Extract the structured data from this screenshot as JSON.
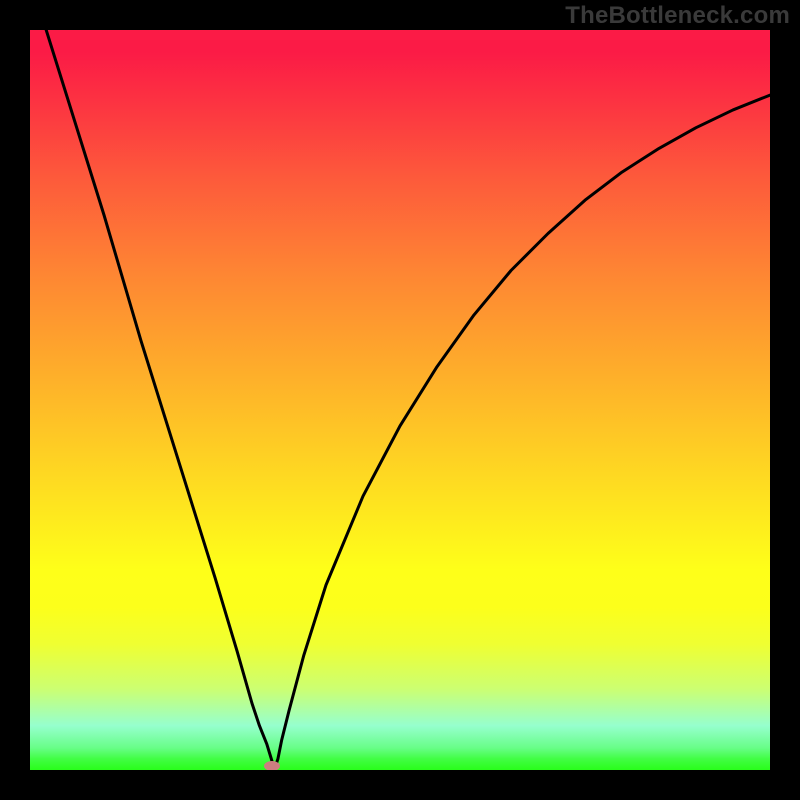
{
  "watermark": "TheBottleneck.com",
  "colors": {
    "frame": "#000000",
    "watermark": "#3a3a3a",
    "curve": "#000000",
    "marker": "#cd7e80",
    "gradient_top": "#fb1b46",
    "gradient_bottom": "#29fe1a"
  },
  "chart_data": {
    "type": "line",
    "title": "",
    "xlabel": "",
    "ylabel": "",
    "xlim": [
      0,
      1
    ],
    "ylim": [
      0,
      1
    ],
    "axes_visible": false,
    "background": "vertical red→yellow→green gradient",
    "annotations": [
      "bottleneck minimum marker near x≈0.33"
    ],
    "series": [
      {
        "name": "bottleneck-curve",
        "x": [
          0.0,
          0.05,
          0.1,
          0.15,
          0.2,
          0.25,
          0.28,
          0.3,
          0.31,
          0.32,
          0.327,
          0.33,
          0.335,
          0.34,
          0.35,
          0.37,
          0.4,
          0.45,
          0.5,
          0.55,
          0.6,
          0.65,
          0.7,
          0.75,
          0.8,
          0.85,
          0.9,
          0.95,
          1.0
        ],
        "y": [
          1.07,
          0.91,
          0.75,
          0.58,
          0.42,
          0.26,
          0.16,
          0.09,
          0.06,
          0.035,
          0.012,
          0.0,
          0.015,
          0.04,
          0.08,
          0.155,
          0.25,
          0.37,
          0.465,
          0.545,
          0.615,
          0.675,
          0.725,
          0.77,
          0.808,
          0.84,
          0.868,
          0.892,
          0.912
        ]
      }
    ],
    "marker": {
      "x": 0.327,
      "y": 0.0
    }
  }
}
